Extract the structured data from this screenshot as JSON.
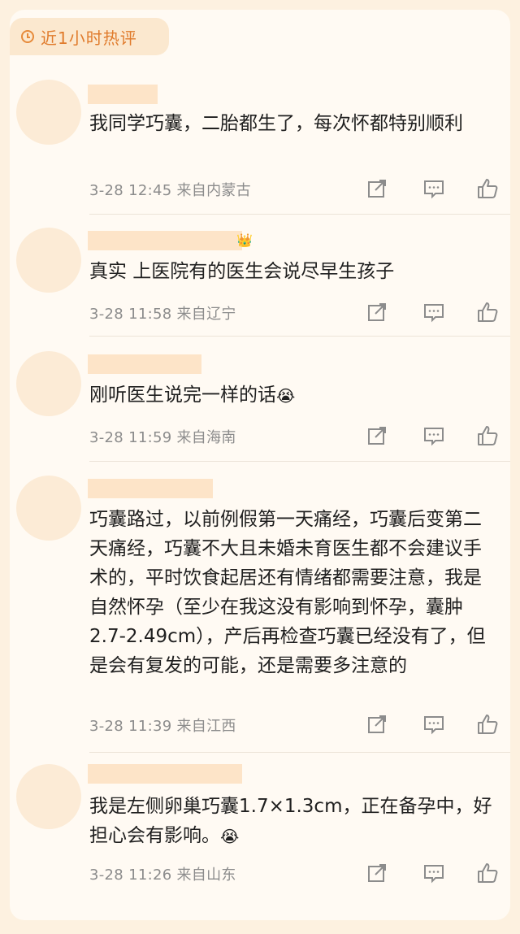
{
  "section": {
    "title": "近1小时热评",
    "icon": "clock-icon"
  },
  "comments": [
    {
      "text": "我同学巧囊，二胎都生了，每次怀都特别顺利",
      "time": "3-28 12:45",
      "location": "来自内蒙古"
    },
    {
      "text": "真实 上医院有的医生会说尽早生孩子",
      "time": "3-28 11:58",
      "location": "来自辽宁",
      "badge": "crown-icon"
    },
    {
      "text": "刚听医生说完一样的话",
      "emoji": "😭",
      "time": "3-28 11:59",
      "location": "来自海南"
    },
    {
      "text": "巧囊路过，以前例假第一天痛经，巧囊后变第二天痛经，巧囊不大且未婚未育医生都不会建议手术的，平时饮食起居还有情绪都需要注意，我是自然怀孕（至少在我这没有影响到怀孕，囊肿2.7-2.49cm），产后再检查巧囊已经没有了，但是会有复发的可能，还是需要多注意的",
      "time": "3-28 11:39",
      "location": "来自江西"
    },
    {
      "text": "我是左侧卵巢巧囊1.7×1.3cm，正在备孕中，好担心会有影响。",
      "emoji": "😭",
      "time": "3-28 11:26",
      "location": "来自山东"
    }
  ]
}
